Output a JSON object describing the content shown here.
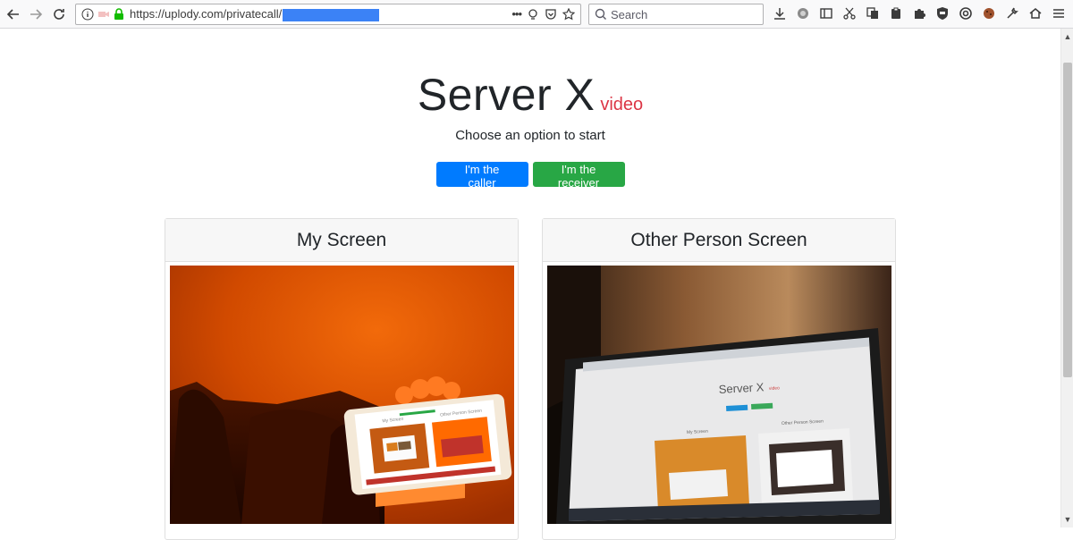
{
  "browser": {
    "url_prefix": "https://uplody.com/privatecall/",
    "search_placeholder": "Search",
    "nav": {
      "back": "back-icon",
      "forward": "forward-icon",
      "reload": "reload-icon"
    }
  },
  "hero": {
    "title": "Server X",
    "title_badge": "video",
    "subtitle": "Choose an option to start"
  },
  "actions": {
    "caller_label": "I'm the caller",
    "receiver_label": "I'm the receiver"
  },
  "panels": {
    "left": {
      "title": "My Screen"
    },
    "right": {
      "title": "Other Person Screen"
    }
  },
  "mini_screen": {
    "title": "Server X",
    "badge": "video",
    "left_label": "My Screen",
    "right_label": "Other Person Screen"
  },
  "colors": {
    "primary": "#007bff",
    "success": "#28a745",
    "danger": "#dc3545"
  }
}
